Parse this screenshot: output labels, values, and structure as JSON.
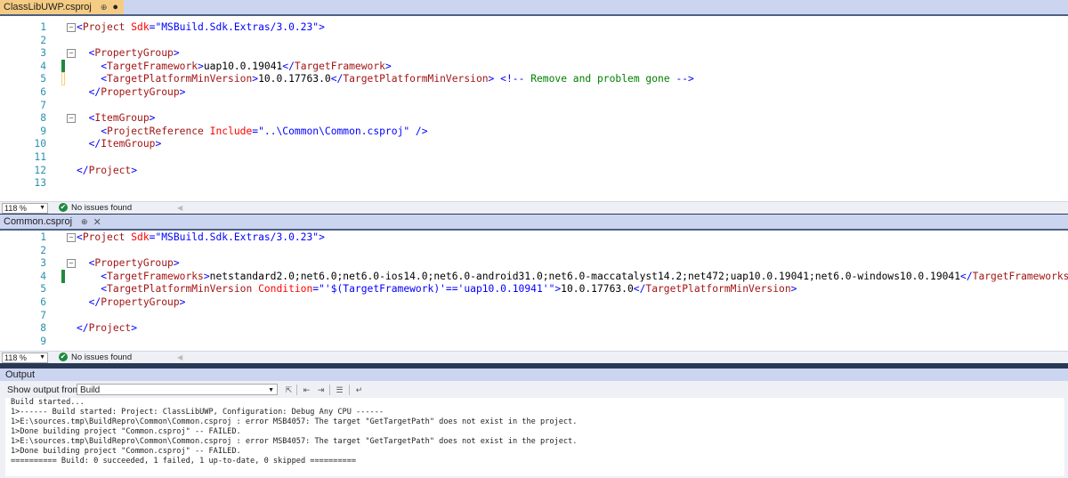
{
  "editor1": {
    "tab": {
      "name": "ClassLibUWP.csproj",
      "pin": "⊕",
      "modified": "●"
    },
    "zoom": "118 %",
    "status": "No issues found",
    "lines": [
      {
        "n": "1",
        "tokens": [
          [
            "p",
            "<"
          ],
          [
            "t",
            "Project"
          ],
          [
            "x",
            " "
          ],
          [
            "a",
            "Sdk"
          ],
          [
            "p",
            "=\""
          ],
          [
            "v",
            "MSBuild.Sdk.Extras/3.0.23"
          ],
          [
            "p",
            "\">"
          ]
        ]
      },
      {
        "n": "2",
        "tokens": []
      },
      {
        "n": "3",
        "tokens": [
          [
            "x",
            "  "
          ],
          [
            "p",
            "<"
          ],
          [
            "t",
            "PropertyGroup"
          ],
          [
            "p",
            ">"
          ]
        ]
      },
      {
        "n": "4",
        "tokens": [
          [
            "x",
            "    "
          ],
          [
            "p",
            "<"
          ],
          [
            "t",
            "TargetFramework"
          ],
          [
            "p",
            ">"
          ],
          [
            "x",
            "uap10.0.19041"
          ],
          [
            "p",
            "</"
          ],
          [
            "t",
            "TargetFramework"
          ],
          [
            "p",
            ">"
          ]
        ]
      },
      {
        "n": "5",
        "tokens": [
          [
            "x",
            "    "
          ],
          [
            "p",
            "<"
          ],
          [
            "t",
            "TargetPlatformMinVersion"
          ],
          [
            "p",
            ">"
          ],
          [
            "x",
            "10.0.17763.0"
          ],
          [
            "p",
            "</"
          ],
          [
            "t",
            "TargetPlatformMinVersion"
          ],
          [
            "p",
            ">"
          ],
          [
            "x",
            " "
          ],
          [
            "p",
            "<!--"
          ],
          [
            "c",
            " Remove and problem gone "
          ],
          [
            "p",
            "-->"
          ]
        ]
      },
      {
        "n": "6",
        "tokens": [
          [
            "x",
            "  "
          ],
          [
            "p",
            "</"
          ],
          [
            "t",
            "PropertyGroup"
          ],
          [
            "p",
            ">"
          ]
        ]
      },
      {
        "n": "7",
        "tokens": []
      },
      {
        "n": "8",
        "tokens": [
          [
            "x",
            "  "
          ],
          [
            "p",
            "<"
          ],
          [
            "t",
            "ItemGroup"
          ],
          [
            "p",
            ">"
          ]
        ]
      },
      {
        "n": "9",
        "tokens": [
          [
            "x",
            "    "
          ],
          [
            "p",
            "<"
          ],
          [
            "t",
            "ProjectReference"
          ],
          [
            "x",
            " "
          ],
          [
            "a",
            "Include"
          ],
          [
            "p",
            "=\""
          ],
          [
            "v",
            "..\\Common\\Common.csproj"
          ],
          [
            "p",
            "\" />"
          ]
        ]
      },
      {
        "n": "10",
        "tokens": [
          [
            "x",
            "  "
          ],
          [
            "p",
            "</"
          ],
          [
            "t",
            "ItemGroup"
          ],
          [
            "p",
            ">"
          ]
        ]
      },
      {
        "n": "11",
        "tokens": []
      },
      {
        "n": "12",
        "tokens": [
          [
            "p",
            "</"
          ],
          [
            "t",
            "Project"
          ],
          [
            "p",
            ">"
          ]
        ]
      },
      {
        "n": "13",
        "tokens": []
      }
    ]
  },
  "editor2": {
    "tab": {
      "name": "Common.csproj",
      "pin": "⊕",
      "close": "✕"
    },
    "zoom": "118 %",
    "status": "No issues found",
    "lines": [
      {
        "n": "1",
        "tokens": [
          [
            "p",
            "<"
          ],
          [
            "t",
            "Project"
          ],
          [
            "x",
            " "
          ],
          [
            "a",
            "Sdk"
          ],
          [
            "p",
            "=\""
          ],
          [
            "v",
            "MSBuild.Sdk.Extras/3.0.23"
          ],
          [
            "p",
            "\">"
          ]
        ]
      },
      {
        "n": "2",
        "tokens": []
      },
      {
        "n": "3",
        "tokens": [
          [
            "x",
            "  "
          ],
          [
            "p",
            "<"
          ],
          [
            "t",
            "PropertyGroup"
          ],
          [
            "p",
            ">"
          ]
        ]
      },
      {
        "n": "4",
        "tokens": [
          [
            "x",
            "    "
          ],
          [
            "p",
            "<"
          ],
          [
            "t",
            "TargetFrameworks"
          ],
          [
            "p",
            ">"
          ],
          [
            "x",
            "netstandard2.0;net6.0;net6.0-ios14.0;net6.0-android31.0;net6.0-maccatalyst14.2;net472;uap10.0.19041;net6.0-windows10.0.19041"
          ],
          [
            "p",
            "</"
          ],
          [
            "t",
            "TargetFrameworks"
          ],
          [
            "p",
            ">"
          ]
        ]
      },
      {
        "n": "5",
        "tokens": [
          [
            "x",
            "    "
          ],
          [
            "p",
            "<"
          ],
          [
            "t",
            "TargetPlatformMinVersion"
          ],
          [
            "x",
            " "
          ],
          [
            "a",
            "Condition"
          ],
          [
            "p",
            "=\""
          ],
          [
            "v",
            "'$(TargetFramework)'=='uap10.0.10941'"
          ],
          [
            "p",
            "\">"
          ],
          [
            "x",
            "10.0.17763.0"
          ],
          [
            "p",
            "</"
          ],
          [
            "t",
            "TargetPlatformMinVersion"
          ],
          [
            "p",
            ">"
          ]
        ]
      },
      {
        "n": "6",
        "tokens": [
          [
            "x",
            "  "
          ],
          [
            "p",
            "</"
          ],
          [
            "t",
            "PropertyGroup"
          ],
          [
            "p",
            ">"
          ]
        ]
      },
      {
        "n": "7",
        "tokens": []
      },
      {
        "n": "8",
        "tokens": [
          [
            "p",
            "</"
          ],
          [
            "t",
            "Project"
          ],
          [
            "p",
            ">"
          ]
        ]
      },
      {
        "n": "9",
        "tokens": []
      }
    ]
  },
  "output": {
    "title": "Output",
    "show_from_label": "Show output from:",
    "source": "Build",
    "text": "Build started...\n1>------ Build started: Project: ClassLibUWP, Configuration: Debug Any CPU ------\n1>E:\\sources.tmp\\BuildRepro\\Common\\Common.csproj : error MSB4057: The target \"GetTargetPath\" does not exist in the project.\n1>Done building project \"Common.csproj\" -- FAILED.\n1>E:\\sources.tmp\\BuildRepro\\Common\\Common.csproj : error MSB4057: The target \"GetTargetPath\" does not exist in the project.\n1>Done building project \"Common.csproj\" -- FAILED.\n========== Build: 0 succeeded, 1 failed, 1 up-to-date, 0 skipped =========="
  },
  "colors": {
    "tag": "#a31515",
    "punct": "#0000ff",
    "attr": "#ff0000",
    "comment": "#008000",
    "line_number": "#2b91af",
    "active_tab": "#f5cc84",
    "changed_saved": "#1e8a3c",
    "changed_unsaved": "#f0d675"
  }
}
